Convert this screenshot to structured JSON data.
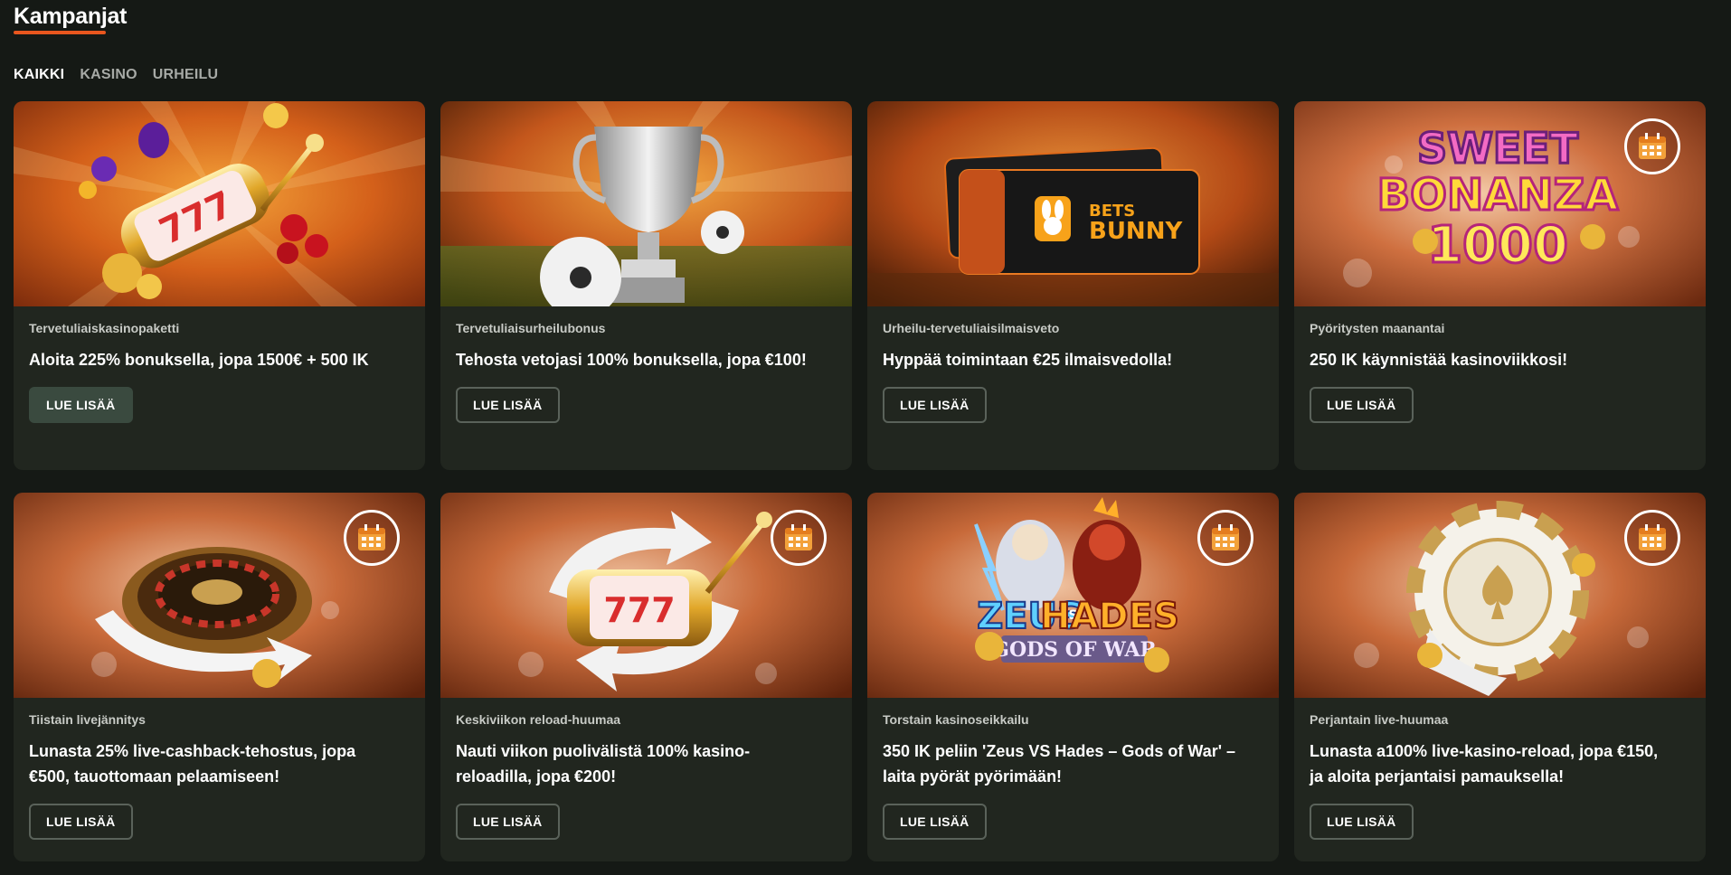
{
  "page": {
    "title": "Kampanjat",
    "accent_color": "#e8561e"
  },
  "filters": [
    {
      "label": "KAIKKI",
      "active": true
    },
    {
      "label": "KASINO",
      "active": false
    },
    {
      "label": "URHEILU",
      "active": false
    }
  ],
  "cards": [
    {
      "category": "Tervetuliaiskasinopaketti",
      "headline": "Aloita 225% bonuksella, jopa 1500€ + 500 IK",
      "button": "LUE LISÄÄ",
      "image_icon": "slot-777-icon",
      "calendar": false
    },
    {
      "category": "Tervetuliaisurheilubonus",
      "headline": "Tehosta vetojasi 100% bonuksella, jopa €100!",
      "button": "LUE LISÄÄ",
      "image_icon": "trophy-icon",
      "calendar": false
    },
    {
      "category": "Urheilu-tervetuliaisilmaisveto",
      "headline": "Hyppää toimintaan €25 ilmaisvedolla!",
      "button": "LUE LISÄÄ",
      "image_icon": "ticket-icon",
      "calendar": false,
      "logo_text": "BETS BUNNY"
    },
    {
      "category": "Pyöritysten maanantai",
      "headline": "250 IK käynnistää kasinoviikkosi!",
      "button": "LUE LISÄÄ",
      "image_icon": "sweet-bonanza-logo",
      "calendar": true,
      "logo_text": "SWEET BONANZA 1000"
    },
    {
      "category": "Tiistain livejännitys",
      "headline": "Lunasta 25% live-cashback-tehostus, jopa €500, tauottomaan pelaamiseen!",
      "button": "LUE LISÄÄ",
      "image_icon": "roulette-icon",
      "calendar": true
    },
    {
      "category": "Keskiviikon reload-huumaa",
      "headline": "Nauti viikon puolivälistä 100% kasino-reloadilla, jopa €200!",
      "button": "LUE LISÄÄ",
      "image_icon": "slot-reload-icon",
      "calendar": true
    },
    {
      "category": "Torstain kasinoseikkailu",
      "headline": "350 IK peliin 'Zeus VS Hades – Gods of War' – laita pyörät pyörimään!",
      "button": "LUE LISÄÄ",
      "image_icon": "zeus-hades-logo",
      "calendar": true,
      "logo_text": "ZEUS VS HADES GODS OF WAR"
    },
    {
      "category": "Perjantain live-huumaa",
      "headline": "Lunasta a100% live-kasino-reload, jopa €150, ja aloita perjantaisi pamauksella!",
      "button": "LUE LISÄÄ",
      "image_icon": "casino-chip-icon",
      "calendar": true
    }
  ]
}
